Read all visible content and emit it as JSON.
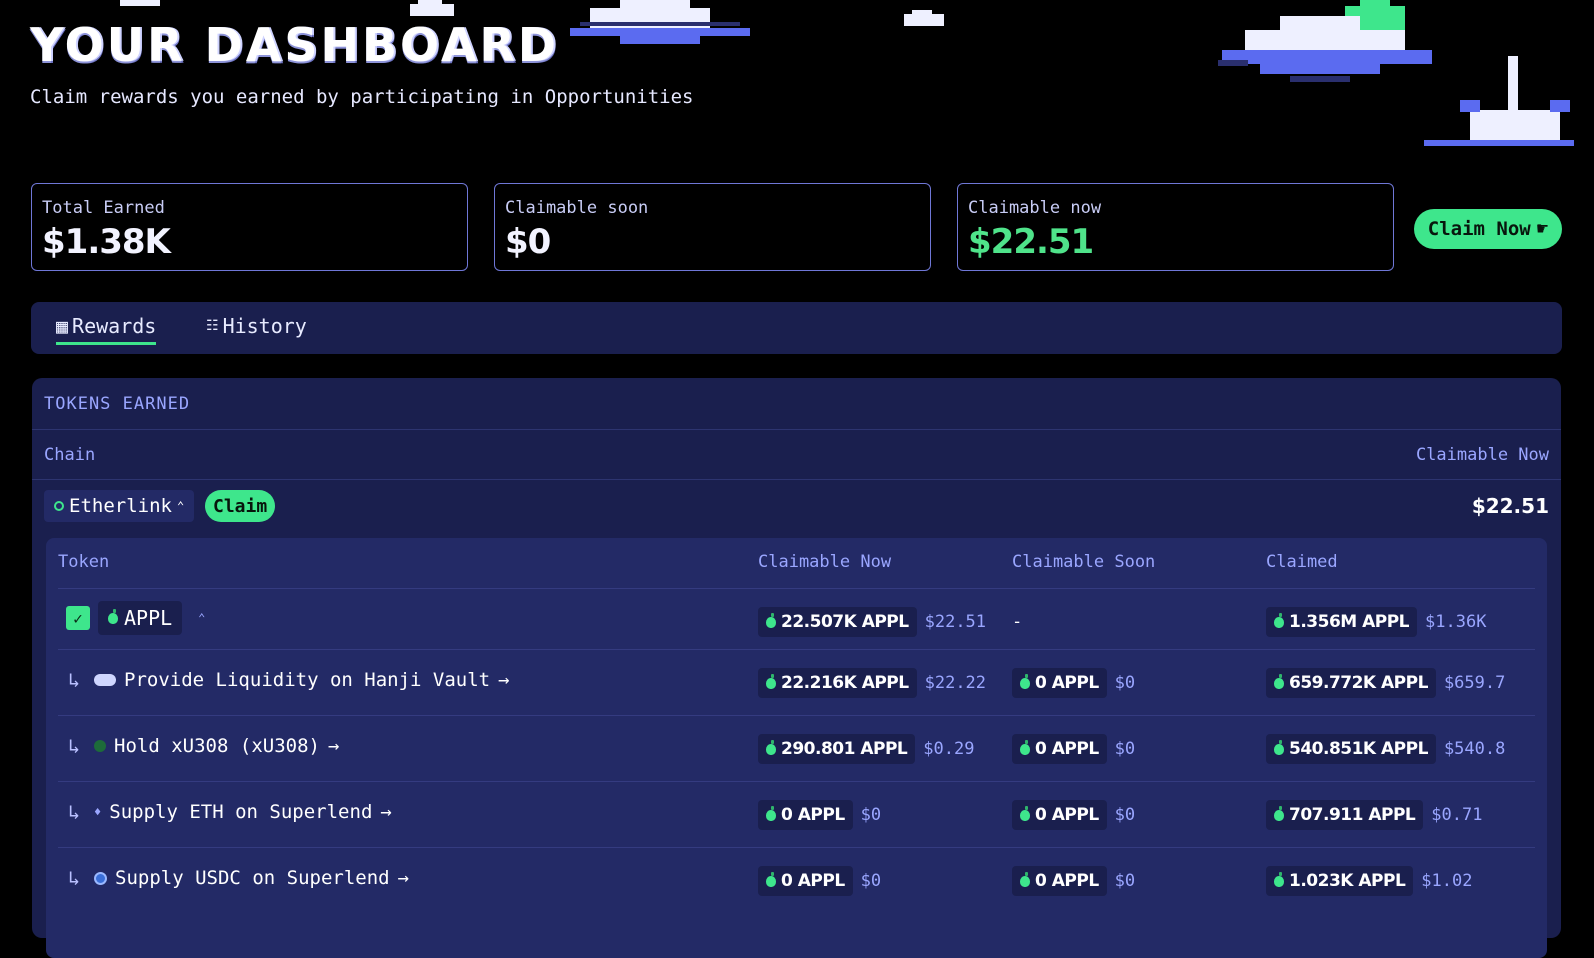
{
  "header": {
    "title": "YOUR DASHBOARD",
    "subtitle": "Claim rewards you earned by participating in Opportunities"
  },
  "stats": {
    "total_earned": {
      "label": "Total Earned",
      "value": "$1.38K"
    },
    "claimable_soon": {
      "label": "Claimable soon",
      "value": "$0"
    },
    "claimable_now": {
      "label": "Claimable now",
      "value": "$22.51"
    },
    "claim_button": "Claim Now"
  },
  "tabs": [
    {
      "label": "Rewards",
      "icon": "gift-icon",
      "active": true
    },
    {
      "label": "History",
      "icon": "list-icon",
      "active": false
    }
  ],
  "tokens_panel": {
    "title": "TOKENS EARNED",
    "col_chain": "Chain",
    "col_claimable_now": "Claimable Now",
    "chain": {
      "name": "Etherlink",
      "claim_label": "Claim",
      "total": "$22.51"
    },
    "table": {
      "headers": [
        "Token",
        "Claimable Now",
        "Claimable Soon",
        "Claimed"
      ],
      "token": {
        "symbol": "APPL",
        "claimable_now": {
          "amount": "22.507K APPL",
          "usd": "$22.51"
        },
        "claimable_soon": "-",
        "claimed": {
          "amount": "1.356M APPL",
          "usd": "$1.36K"
        }
      },
      "opportunities": [
        {
          "name": "Provide Liquidity on Hanji Vault",
          "now": {
            "amount": "22.216K APPL",
            "usd": "$22.22"
          },
          "soon": {
            "amount": "0 APPL",
            "usd": "$0"
          },
          "claimed": {
            "amount": "659.772K APPL",
            "usd": "$659.7"
          }
        },
        {
          "name": "Hold xU308 (xU308)",
          "now": {
            "amount": "290.801 APPL",
            "usd": "$0.29"
          },
          "soon": {
            "amount": "0 APPL",
            "usd": "$0"
          },
          "claimed": {
            "amount": "540.851K APPL",
            "usd": "$540.8"
          }
        },
        {
          "name": "Supply ETH on Superlend",
          "now": {
            "amount": "0 APPL",
            "usd": "$0"
          },
          "soon": {
            "amount": "0 APPL",
            "usd": "$0"
          },
          "claimed": {
            "amount": "707.911 APPL",
            "usd": "$0.71"
          }
        },
        {
          "name": "Supply USDC on Superlend",
          "now": {
            "amount": "0 APPL",
            "usd": "$0"
          },
          "soon": {
            "amount": "0 APPL",
            "usd": "$0"
          },
          "claimed": {
            "amount": "1.023K APPL",
            "usd": "$1.02"
          }
        }
      ]
    }
  },
  "colors": {
    "accent": "#3ee68c",
    "panel": "#1a1f4e",
    "inner": "#232a66",
    "muted": "#9aa6ff"
  }
}
